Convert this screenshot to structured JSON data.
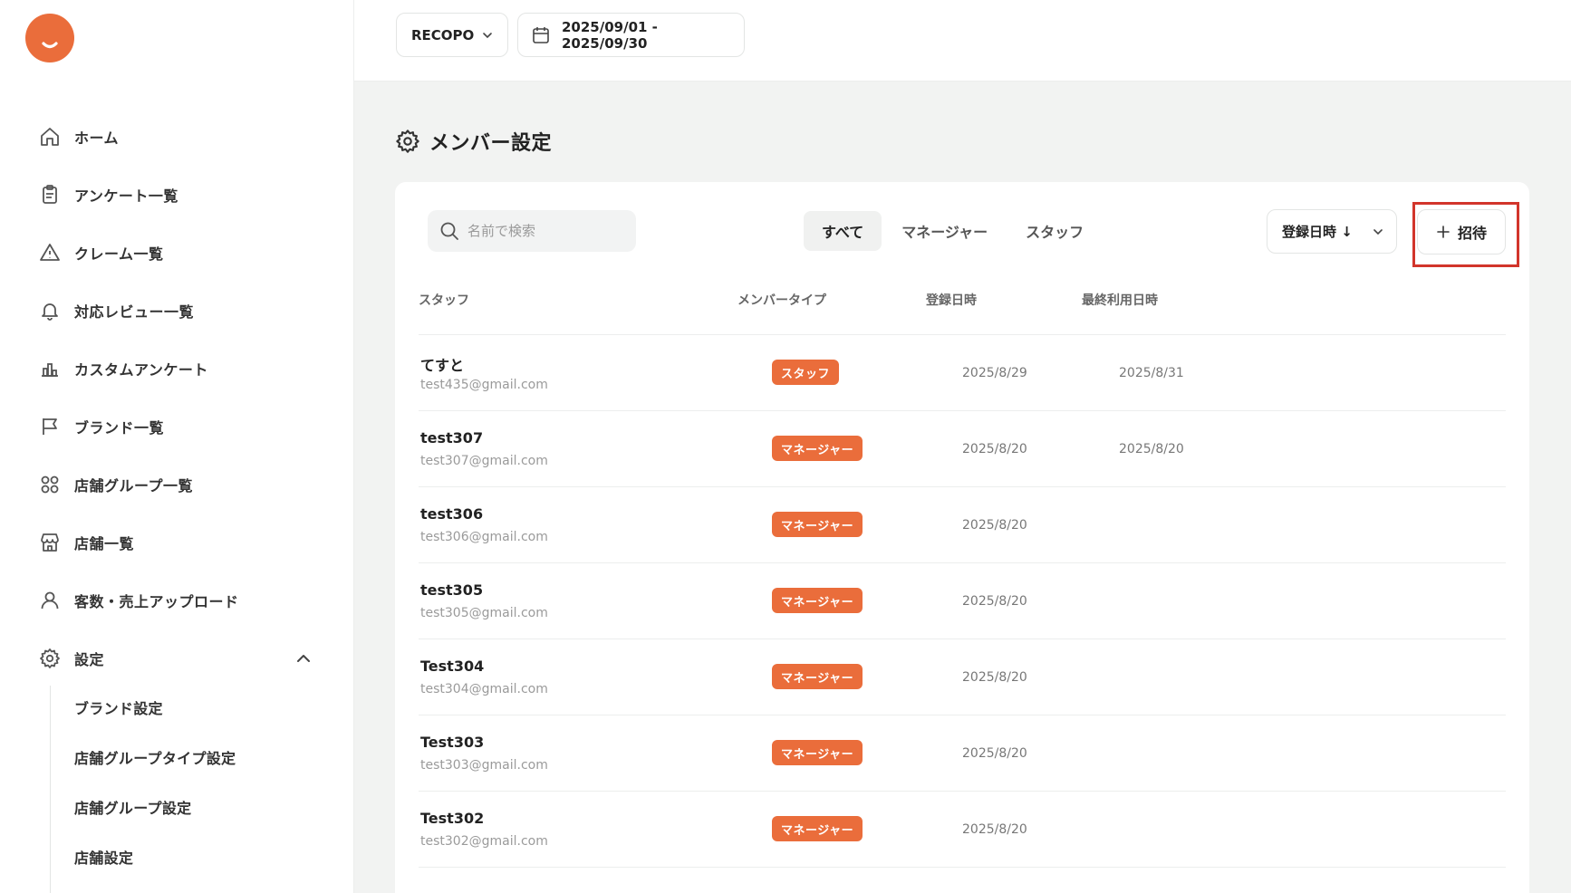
{
  "sidebar": {
    "logo": "smile-logo",
    "items": [
      {
        "label": "ホーム",
        "icon": "home-icon"
      },
      {
        "label": "アンケート一覧",
        "icon": "clipboard-icon"
      },
      {
        "label": "クレーム一覧",
        "icon": "warning-icon"
      },
      {
        "label": "対応レビュー一覧",
        "icon": "bell-icon"
      },
      {
        "label": "カスタムアンケート",
        "icon": "chart-icon"
      },
      {
        "label": "ブランド一覧",
        "icon": "flag-icon"
      },
      {
        "label": "店舗グループ一覧",
        "icon": "grid-icon"
      },
      {
        "label": "店舗一覧",
        "icon": "store-icon"
      },
      {
        "label": "客数・売上アップロード",
        "icon": "user-icon"
      },
      {
        "label": "設定",
        "icon": "gear-icon"
      }
    ],
    "sub_items": [
      {
        "label": "ブランド設定"
      },
      {
        "label": "店舗グループタイプ設定"
      },
      {
        "label": "店舗グループ設定"
      },
      {
        "label": "店舗設定"
      }
    ]
  },
  "topbar": {
    "brand_select": "RECOPO",
    "date_range": "2025/09/01 - 2025/09/30"
  },
  "page": {
    "title": "メンバー設定"
  },
  "toolbar": {
    "search_placeholder": "名前で検索",
    "tabs": [
      {
        "label": "すべて",
        "active": true
      },
      {
        "label": "マネージャー",
        "active": false
      },
      {
        "label": "スタッフ",
        "active": false
      }
    ],
    "sort_label": "登録日時 ↓",
    "invite_label": "招待"
  },
  "table": {
    "headers": {
      "staff": "スタッフ",
      "member_type": "メンバータイプ",
      "registered": "登録日時",
      "last_used": "最終利用日時"
    },
    "rows": [
      {
        "name": "てすと",
        "email": "test435@gmail.com",
        "type": "スタッフ",
        "registered": "2025/8/29",
        "last_used": "2025/8/31"
      },
      {
        "name": "test307",
        "email": "test307@gmail.com",
        "type": "マネージャー",
        "registered": "2025/8/20",
        "last_used": "2025/8/20"
      },
      {
        "name": "test306",
        "email": "test306@gmail.com",
        "type": "マネージャー",
        "registered": "2025/8/20",
        "last_used": ""
      },
      {
        "name": "test305",
        "email": "test305@gmail.com",
        "type": "マネージャー",
        "registered": "2025/8/20",
        "last_used": ""
      },
      {
        "name": "Test304",
        "email": "test304@gmail.com",
        "type": "マネージャー",
        "registered": "2025/8/20",
        "last_used": ""
      },
      {
        "name": "Test303",
        "email": "test303@gmail.com",
        "type": "マネージャー",
        "registered": "2025/8/20",
        "last_used": ""
      },
      {
        "name": "Test302",
        "email": "test302@gmail.com",
        "type": "マネージャー",
        "registered": "2025/8/20",
        "last_used": ""
      }
    ]
  },
  "colors": {
    "accent": "#ea6d3b",
    "highlight_box": "#d2352b",
    "background": "#f2f3f2"
  }
}
